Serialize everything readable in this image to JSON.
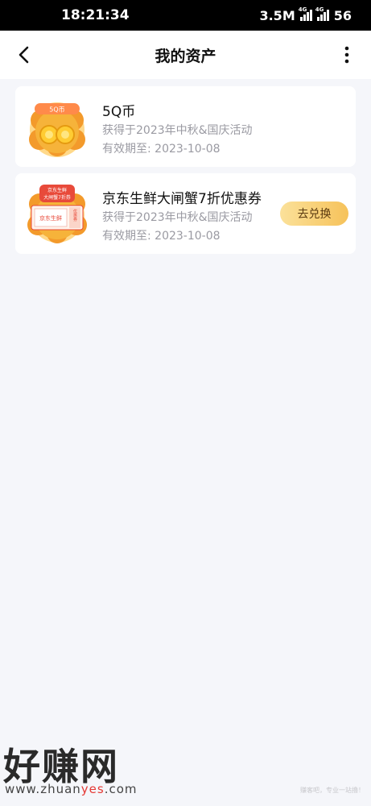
{
  "status_bar": {
    "time": "18:21:34",
    "net_speed": "3.5M",
    "signal_tag_1": "4G",
    "signal_tag_2": "4G",
    "battery": "56"
  },
  "nav": {
    "title": "我的资产",
    "back_icon": "chevron-left-icon",
    "more_icon": "more-vertical-icon"
  },
  "assets": [
    {
      "title": "5Q币",
      "badge_text": "5Q币",
      "source": "获得于2023年中秋&国庆活动",
      "expiry": "有效期至: 2023-10-08"
    },
    {
      "title": "京东生鲜大闸蟹7折优惠券",
      "badge_text": "京东生鲜",
      "badge_text_2": "大闸蟹7折券",
      "ticket_text": "京东生鲜",
      "ticket_stub": "优惠券",
      "source": "获得于2023年中秋&国庆活动",
      "expiry": "有效期至: 2023-10-08",
      "action_label": "去兑换"
    }
  ],
  "watermark": {
    "brand_cn": "好赚网",
    "url_pre": "www.zhuan",
    "url_accent": "yes",
    "url_post": ".com",
    "tiny_note": "赚客吧，专业一站撸！"
  },
  "colors": {
    "accent_gold": "#f6c25a",
    "badge_orange": "#f39a2b",
    "background": "#f5f6fa"
  }
}
